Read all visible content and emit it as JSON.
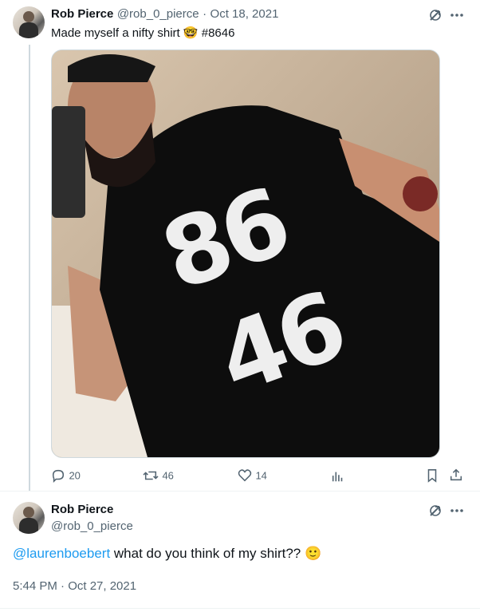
{
  "tweet1": {
    "name": "Rob Pierce",
    "handle": "@rob_0_pierce",
    "dot": "·",
    "date": "Oct 18, 2021",
    "text": "Made myself a nifty shirt 🤓 #8646",
    "shirt_text_line1": "86",
    "shirt_text_line2": "46",
    "replies": "20",
    "retweets": "46",
    "likes": "14"
  },
  "tweet2": {
    "name": "Rob Pierce",
    "handle": "@rob_0_pierce",
    "mention": "@laurenboebert",
    "text": " what do you think of my shirt?? 🙂",
    "timestamp": "5:44 PM · Oct 27, 2021"
  },
  "icons": [
    "grok-icon",
    "more-icon",
    "reply-icon",
    "retweet-icon",
    "like-icon",
    "views-icon",
    "bookmark-icon",
    "share-icon"
  ],
  "colors": {
    "accent": "#1d9bf0",
    "muted": "#536471",
    "text": "#0f1419"
  }
}
